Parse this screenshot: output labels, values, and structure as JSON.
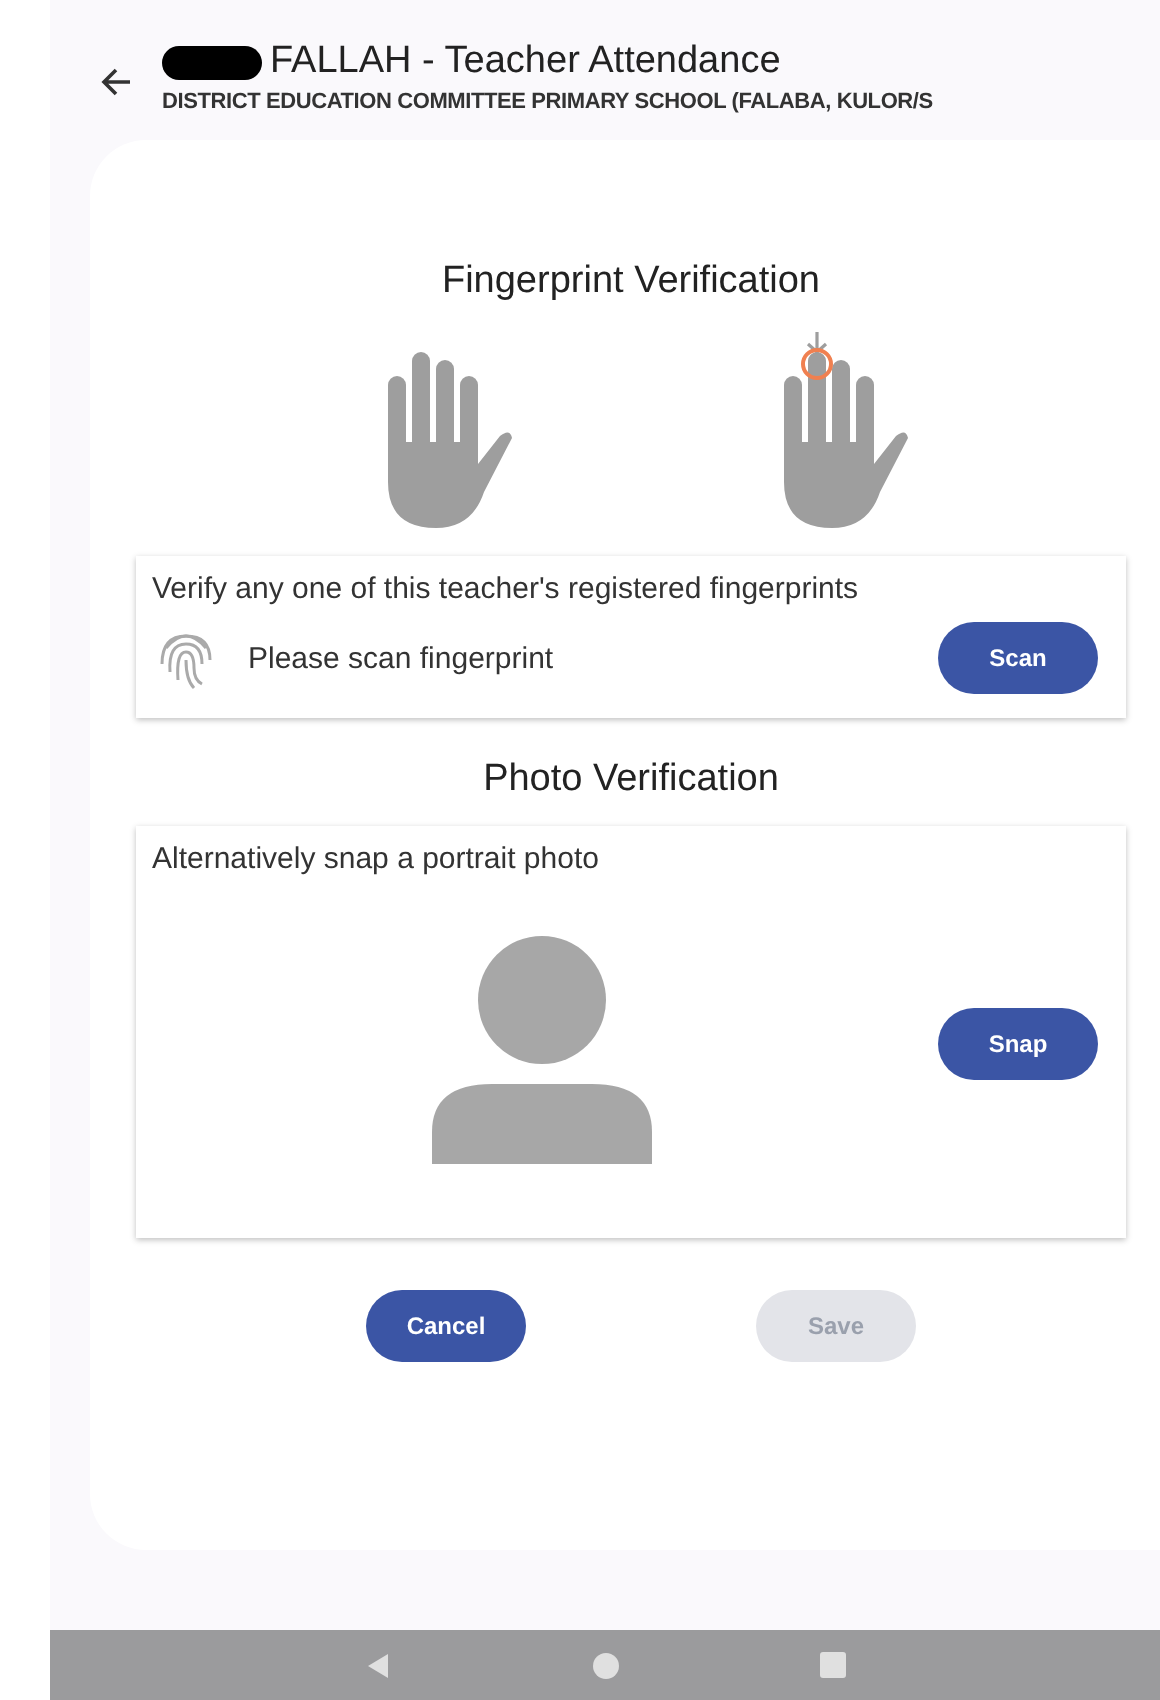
{
  "header": {
    "title": "FALLAH  - Teacher Attendance",
    "subtitle": "DISTRICT EDUCATION COMMITTEE PRIMARY SCHOOL (FALABA, KULOR/S"
  },
  "fingerprint": {
    "heading": "Fingerprint Verification",
    "instruction": "Verify any one of this teacher's registered fingerprints",
    "status": "Please scan fingerprint",
    "button": {
      "label": "Scan",
      "disabled": false
    }
  },
  "photo": {
    "heading": "Photo Verification",
    "instruction": "Alternatively snap a portrait photo",
    "button": {
      "label": "Snap",
      "disabled": false
    }
  },
  "actions": [
    {
      "label": "Cancel",
      "disabled": false
    },
    {
      "label": "Save",
      "disabled": true
    }
  ]
}
